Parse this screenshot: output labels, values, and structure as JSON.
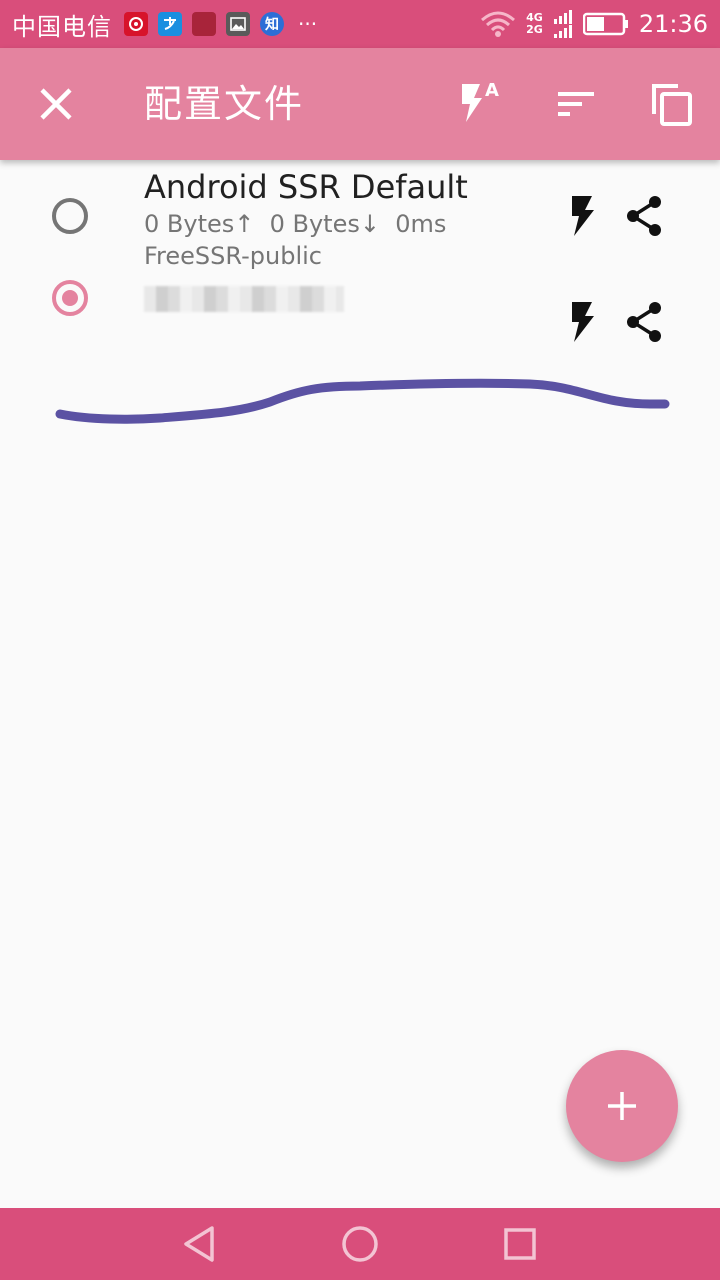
{
  "status_bar": {
    "carrier": "中国电信",
    "notification_icons": [
      "netease-music-icon",
      "alipay-icon",
      "app-icon",
      "gallery-icon",
      "zhihu-icon"
    ],
    "zhihu_label": "知",
    "more": "···",
    "network": "4G 2G",
    "net_4g": "4G",
    "net_2g": "2G",
    "time": "21:36"
  },
  "app_bar": {
    "title": "配置文件",
    "color": "#e4839f",
    "auto_test_badge": "A"
  },
  "profiles": [
    {
      "name": "Android SSR Default",
      "stats": "0 Bytes↑  0 Bytes↓  0ms",
      "group": "FreeSSR-public",
      "selected": false
    },
    {
      "name": "",
      "stats": "",
      "group": "",
      "selected": true
    }
  ],
  "fab": {
    "label": "+"
  },
  "colors": {
    "status_bar": "#d94e7b",
    "app_bar": "#e4839f",
    "accent": "#e4839f",
    "scribble": "#5b52a3",
    "background": "#fafafa"
  }
}
